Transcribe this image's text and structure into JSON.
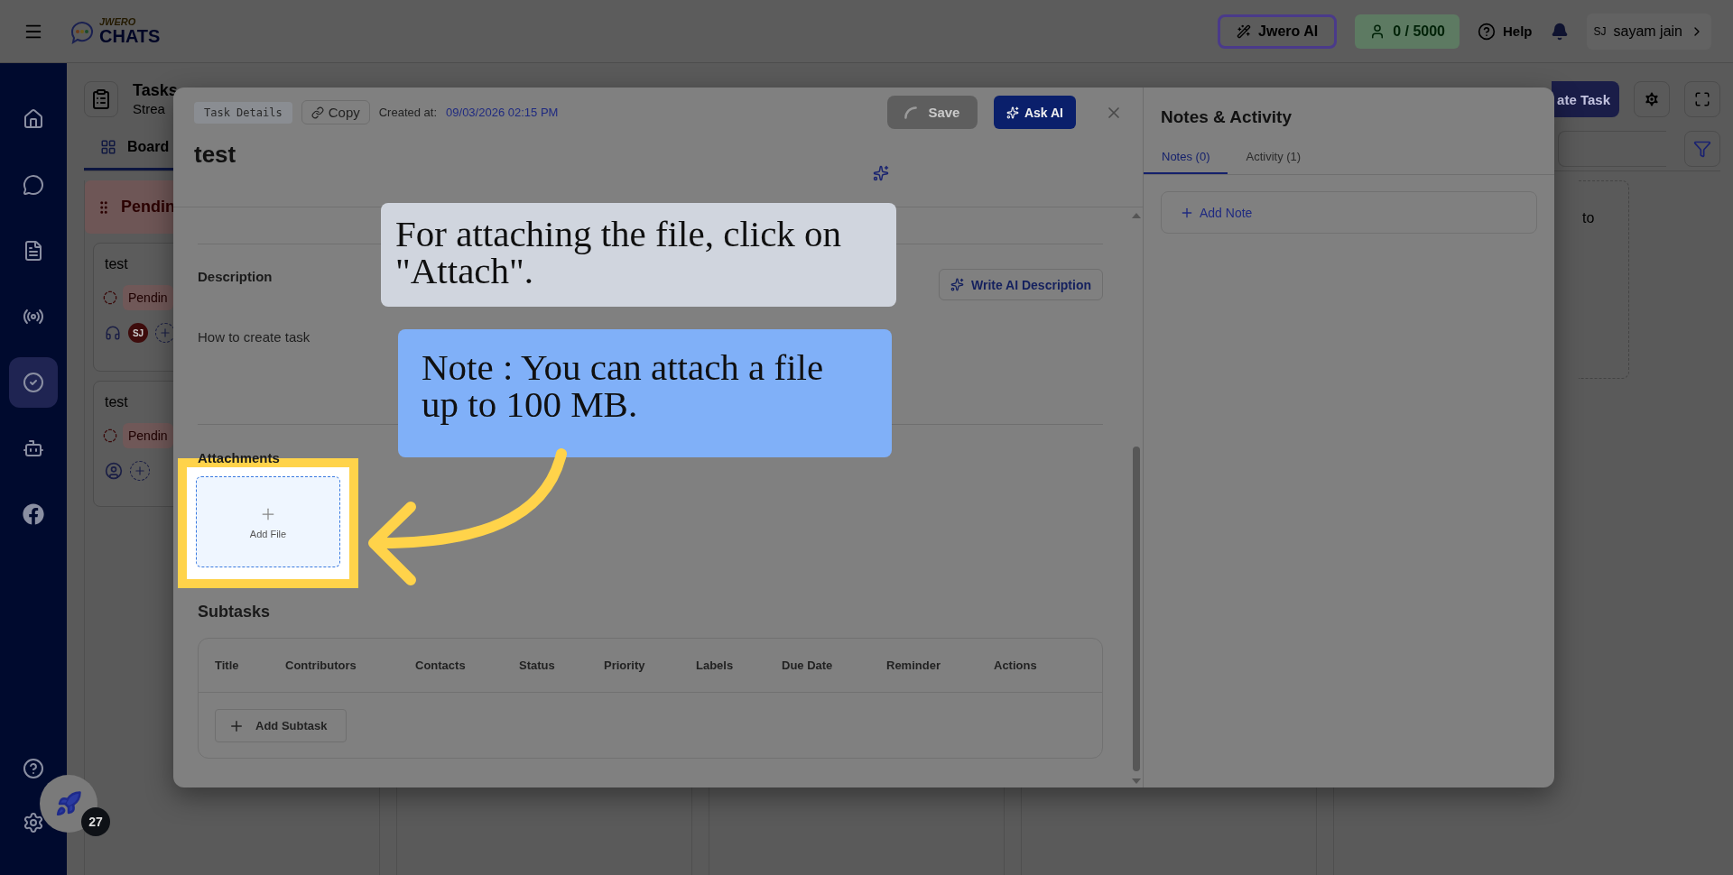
{
  "topbar": {
    "logo_top": "JWERO",
    "logo_bottom": "CHATS",
    "ai_button": "Jwero AI",
    "credits": "0 / 5000",
    "help": "Help",
    "user_initials": "SJ",
    "user_name": "sayam jain"
  },
  "sidebar": {
    "items": [
      {
        "kind": "home",
        "selected": false
      },
      {
        "kind": "chat",
        "selected": false
      },
      {
        "kind": "document",
        "selected": false
      },
      {
        "kind": "broadcast",
        "selected": false
      },
      {
        "kind": "tasks",
        "selected": true
      },
      {
        "kind": "bot",
        "selected": false
      },
      {
        "kind": "facebook",
        "selected": false
      }
    ],
    "bottom_items": [
      {
        "kind": "help"
      },
      {
        "kind": "settings"
      }
    ]
  },
  "page": {
    "title": "Tasks",
    "subtitle": "Strea",
    "view_tab": "Board",
    "create_button": "ate Task",
    "column_text": "to"
  },
  "board": {
    "column_title": "Pendin",
    "cards": [
      {
        "title": "test",
        "status": "Pendin",
        "kind": "assigned",
        "avatar": "SJ"
      },
      {
        "title": "test",
        "status": "Pendin",
        "kind": "unassigned"
      }
    ]
  },
  "task_modal": {
    "chip": "Task Details",
    "copy_button": "Copy",
    "created_label": "Created at:",
    "created_value": "09/03/2026 02:15 PM",
    "save_button": {
      "label": "Save",
      "disabled": true
    },
    "ask_ai_button": "Ask AI",
    "title": "test",
    "description": {
      "label": "Description",
      "ai_button": "Write AI Description",
      "text": "How to create task"
    },
    "attachments": {
      "label": "Attachments",
      "add_file": "Add File"
    },
    "subtasks": {
      "label": "Subtasks",
      "columns": [
        "Title",
        "Contributors",
        "Contacts",
        "Status",
        "Priority",
        "Labels",
        "Due Date",
        "Reminder",
        "Actions"
      ],
      "add_button": "Add Subtask"
    }
  },
  "notes_panel": {
    "title": "Notes & Activity",
    "tabs": [
      {
        "label": "Notes (0)",
        "selected": true
      },
      {
        "label": "Activity (1)",
        "selected": false
      }
    ],
    "add_note": "Add Note"
  },
  "guide": {
    "callouts": [
      {
        "kind": "tip",
        "text": "For attaching the file, click on \"Attach\"."
      },
      {
        "kind": "note",
        "text": "Note : You can attach a file up to 100 MB."
      }
    ]
  },
  "launcher": {
    "badge": "27"
  }
}
